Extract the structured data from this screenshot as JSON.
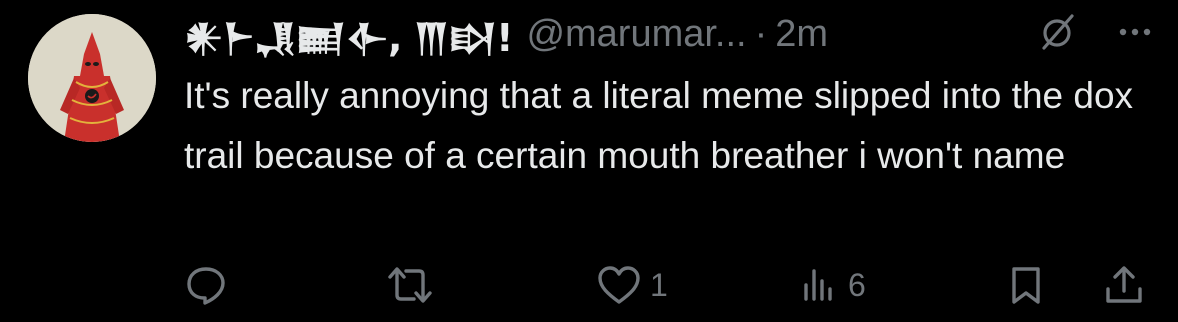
{
  "post": {
    "display_name": "𒀭𒈨𒂗𒆤𒅆, 𒐈𒊭!",
    "handle": "@marumar...",
    "separator": "·",
    "timestamp": "2m",
    "text": "It's really annoying that a literal meme slipped into the dox trail because of a certain mouth breather i won't name"
  },
  "actions": {
    "reply_count": "",
    "repost_count": "",
    "like_count": "1",
    "views_count": "6"
  },
  "colors": {
    "background": "#000000",
    "text_primary": "#e7e9ea",
    "text_secondary": "#71767b",
    "avatar_background": "#dcd8c8",
    "avatar_figure": "#c9302c"
  },
  "icons": {
    "header": [
      "grok-icon",
      "more-icon"
    ],
    "action_bar": [
      "reply-icon",
      "repost-icon",
      "like-icon",
      "views-icon",
      "bookmark-icon",
      "share-icon"
    ]
  }
}
